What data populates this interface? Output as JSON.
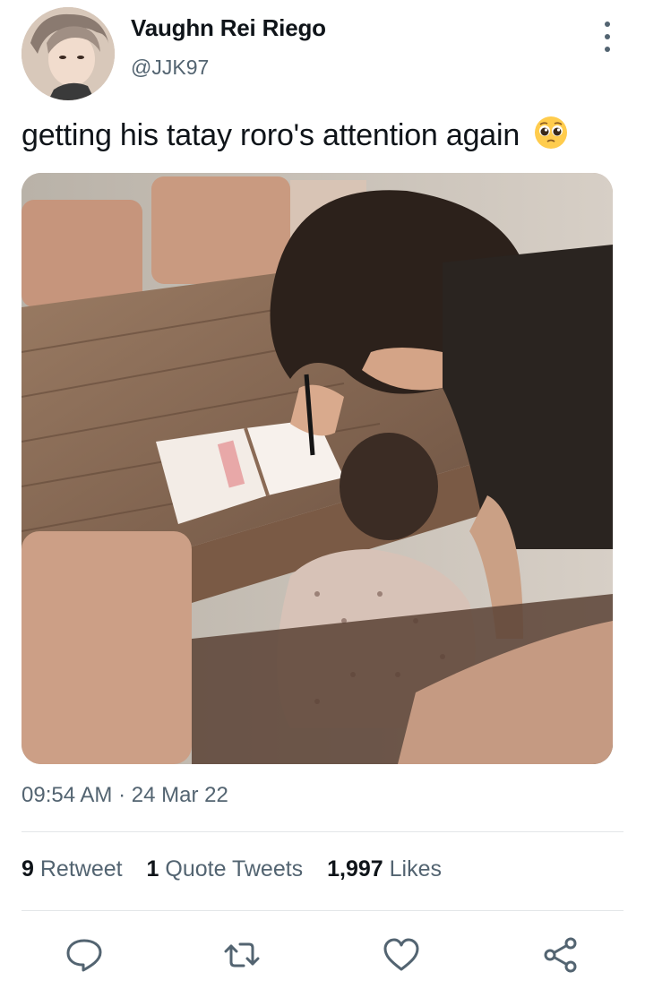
{
  "author": {
    "display_name": "Vaughn Rei Riego",
    "handle": "@JJK97",
    "avatar_icon": "profile-photo"
  },
  "tweet": {
    "text": "getting his tatay roro's attention again",
    "emoji": "pleading-face-emoji",
    "media_description_icon": "photo"
  },
  "meta": {
    "time": "09:54 AM",
    "separator": "·",
    "date": "24 Mar 22"
  },
  "stats": {
    "retweets_count": "9",
    "retweets_label": "Retweet",
    "quotes_count": "1",
    "quotes_label": "Quote Tweets",
    "likes_count": "1,997",
    "likes_label": "Likes"
  },
  "actions": [
    "reply-icon",
    "retweet-icon",
    "like-icon",
    "share-icon"
  ],
  "colors": {
    "secondary_text": "#536471",
    "primary_text": "#0f1419",
    "divider": "#e3e6e8"
  }
}
